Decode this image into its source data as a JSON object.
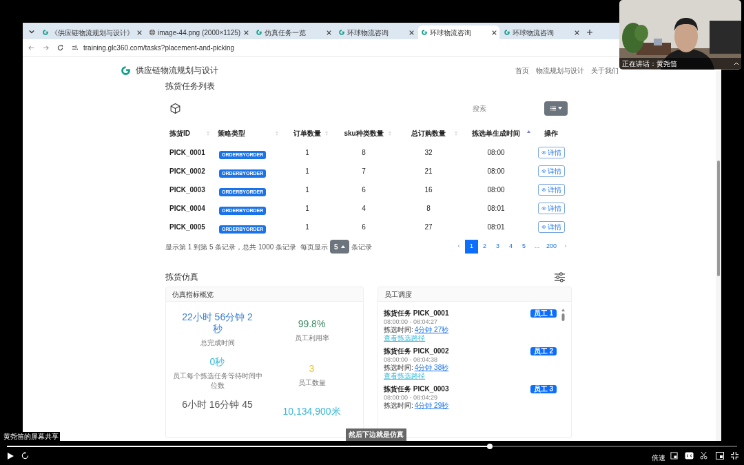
{
  "browser": {
    "tabs": [
      {
        "title": "《供应链物流规划与设计》",
        "kind": "site",
        "selected": false
      },
      {
        "title": "image-44.png (2000×1125)",
        "selected": false
      },
      {
        "title": "仿真任务一览",
        "kind": "site",
        "selected": false
      },
      {
        "title": "环球物流咨询",
        "kind": "site",
        "selected": false
      },
      {
        "title": "环球物流咨询",
        "kind": "site",
        "selected": true
      },
      {
        "title": "环球物流咨询",
        "kind": "site",
        "selected": false
      }
    ],
    "url": "training.glc360.com/tasks?placement-and-picking"
  },
  "site": {
    "brand": "供应链物流规划与设计",
    "nav": [
      "首页",
      "物流规划与设计",
      "关于我们"
    ]
  },
  "task_list": {
    "title": "拣货任务列表",
    "search_placeholder": "搜索",
    "columns": [
      {
        "label": "拣货ID",
        "sorted": false
      },
      {
        "label": "策略类型",
        "sorted": false
      },
      {
        "label": "订单数量",
        "sorted": false
      },
      {
        "label": "sku种类数量",
        "sorted": false
      },
      {
        "label": "总订购数量",
        "sorted": false
      },
      {
        "label": "拣选单生成时间",
        "sorted": true
      },
      {
        "label": "操作"
      }
    ],
    "rows": [
      {
        "id": "PICK_0001",
        "strategy": "ORDERBYORDER",
        "orders": "1",
        "sku": "8",
        "total": "32",
        "time": "08:00",
        "action": "详情"
      },
      {
        "id": "PICK_0002",
        "strategy": "ORDERBYORDER",
        "orders": "1",
        "sku": "7",
        "total": "21",
        "time": "08:00",
        "action": "详情"
      },
      {
        "id": "PICK_0003",
        "strategy": "ORDERBYORDER",
        "orders": "1",
        "sku": "6",
        "total": "16",
        "time": "08:00",
        "action": "详情"
      },
      {
        "id": "PICK_0004",
        "strategy": "ORDERBYORDER",
        "orders": "1",
        "sku": "4",
        "total": "8",
        "time": "08:01",
        "action": "详情"
      },
      {
        "id": "PICK_0005",
        "strategy": "ORDERBYORDER",
        "orders": "1",
        "sku": "6",
        "total": "27",
        "time": "08:01",
        "action": "详情"
      }
    ],
    "pagination": {
      "summary": "显示第 1 到第 5 条记录，总共 1000 条记录",
      "per_page_label": "每页显示",
      "per_page": "5",
      "per_page_suffix": "条记录",
      "prev": "‹",
      "next": "›",
      "pages": [
        {
          "label": "1",
          "selected": true
        },
        {
          "label": "2",
          "selected": false
        },
        {
          "label": "3",
          "selected": false
        },
        {
          "label": "4",
          "selected": false
        },
        {
          "label": "5",
          "selected": false
        },
        {
          "label": "...",
          "selected": false
        },
        {
          "label": "200",
          "selected": false
        }
      ]
    }
  },
  "simulation": {
    "title": "拣货仿真",
    "metrics_card": {
      "title": "仿真指标概览",
      "metrics": [
        {
          "value": "22小时 56分钟 2秒",
          "label": "总完成时间",
          "color": "#3a7fd5"
        },
        {
          "value": "99.8%",
          "label": "员工利用率",
          "color": "#3d8a66"
        },
        {
          "value": "0秒",
          "label": "员工每个拣选任务等待时间中位数",
          "color": "#35b8d9"
        },
        {
          "value": "3",
          "label": "员工数量",
          "color": "#f0c419"
        },
        {
          "value": "6小时 16分钟 45",
          "color": "#555555"
        },
        {
          "value": "10,134,900米",
          "color": "#35b8d9"
        }
      ]
    },
    "schedule_card": {
      "title": "员工调度",
      "tasks": [
        {
          "title": "拣货任务 PICK_0001",
          "time_range": "08:00:00 - 08:04:27",
          "duration_label": "拣选时间:",
          "duration": "4分钟 27秒",
          "link": "查看拣选路径",
          "worker": "员工 1"
        },
        {
          "title": "拣货任务 PICK_0002",
          "time_range": "08:00:00 - 08:04:38",
          "duration_label": "拣选时间:",
          "duration": "4分钟 38秒",
          "link": "查看拣选路径",
          "worker": "员工 2"
        },
        {
          "title": "拣货任务 PICK_0003",
          "time_range": "08:00:00 - 08:04:29",
          "duration_label": "拣选时间:",
          "duration": "4分钟 29秒",
          "worker": "员工 3"
        }
      ]
    }
  },
  "video": {
    "speaker": "正在讲话：黄尧笛",
    "share_caption": "黄尧笛的屏幕共享",
    "subtitle": "然后下边就是仿真",
    "speed": "倍速",
    "progress": {
      "level": 0.661
    }
  }
}
